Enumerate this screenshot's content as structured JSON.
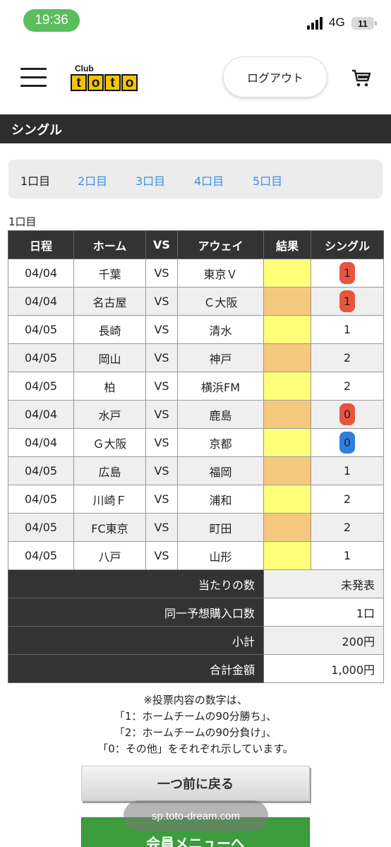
{
  "status_bar": {
    "time": "19:36",
    "network": "4G",
    "battery": "11"
  },
  "header": {
    "logo_club": "Club",
    "logo_letters": [
      "t",
      "o",
      "t",
      "o"
    ],
    "logout_label": "ログアウト",
    "cart_icon": "cart-icon",
    "menu_icon": "hamburger-icon"
  },
  "section_title": "シングル",
  "tabs": [
    "1口目",
    "2口目",
    "3口目",
    "4口目",
    "5口目"
  ],
  "round_label": "1口目",
  "table": {
    "headers": [
      "日程",
      "ホーム",
      "VS",
      "アウェイ",
      "結果",
      "シングル"
    ],
    "rows": [
      {
        "date": "04/04",
        "home": "千葉",
        "vs": "VS",
        "away": "東京Ｖ",
        "pick": "1",
        "mark": "red"
      },
      {
        "date": "04/04",
        "home": "名古屋",
        "vs": "VS",
        "away": "Ｃ大阪",
        "pick": "1",
        "mark": "red"
      },
      {
        "date": "04/05",
        "home": "長崎",
        "vs": "VS",
        "away": "清水",
        "pick": "1",
        "mark": "none"
      },
      {
        "date": "04/05",
        "home": "岡山",
        "vs": "VS",
        "away": "神戸",
        "pick": "2",
        "mark": "none"
      },
      {
        "date": "04/05",
        "home": "柏",
        "vs": "VS",
        "away": "横浜FM",
        "pick": "2",
        "mark": "none"
      },
      {
        "date": "04/04",
        "home": "水戸",
        "vs": "VS",
        "away": "鹿島",
        "pick": "0",
        "mark": "red"
      },
      {
        "date": "04/04",
        "home": "Ｇ大阪",
        "vs": "VS",
        "away": "京都",
        "pick": "0",
        "mark": "blue"
      },
      {
        "date": "04/05",
        "home": "広島",
        "vs": "VS",
        "away": "福岡",
        "pick": "1",
        "mark": "none"
      },
      {
        "date": "04/05",
        "home": "川崎Ｆ",
        "vs": "VS",
        "away": "浦和",
        "pick": "2",
        "mark": "none"
      },
      {
        "date": "04/05",
        "home": "FC東京",
        "vs": "VS",
        "away": "町田",
        "pick": "2",
        "mark": "none"
      },
      {
        "date": "04/05",
        "home": "八戸",
        "vs": "VS",
        "away": "山形",
        "pick": "1",
        "mark": "none"
      }
    ],
    "summary": [
      {
        "label": "当たりの数",
        "value": "未発表"
      },
      {
        "label": "同一予想購入口数",
        "value": "1口"
      },
      {
        "label": "小計",
        "value": "200円"
      },
      {
        "label": "合計金額",
        "value": "1,000円"
      }
    ]
  },
  "notes": [
    "※投票内容の数字は、",
    "「1：ホームチームの90分勝ち」、",
    "「2：ホームチームの90分負け」、",
    "「0：その他」をそれぞれ示しています。"
  ],
  "back_button": "一つ前に戻る",
  "member_button": "会員メニューへ",
  "url": "sp.toto-dream.com",
  "colors": {
    "header_bar": "#2d2d2d",
    "link": "#3a8ee6",
    "result_yellow": "#ffff7a",
    "result_orange": "#f5c97d",
    "mark_red": "#e8553e",
    "mark_blue": "#2f7fe0",
    "member_green": "#3c9d3c"
  }
}
